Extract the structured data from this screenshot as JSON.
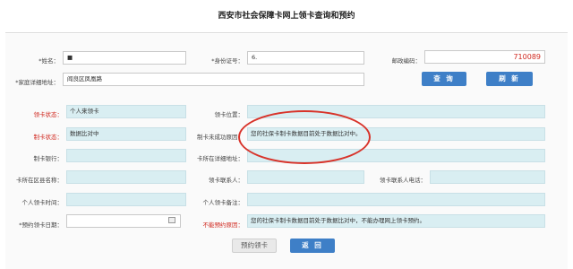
{
  "page": {
    "title": "西安市社会保障卡网上领卡查询和预约"
  },
  "query": {
    "name_label": "*姓名：",
    "name_value": "■",
    "id_label": "*身份证号：",
    "id_value": "6.",
    "postcode_label": "邮政编码：",
    "postcode_value": "710089",
    "address_label": "*家庭详细地址：",
    "address_value": "阎良区凤凰路",
    "search_button": "查 询",
    "refresh_button": "刷 新"
  },
  "result": {
    "status_label": "领卡状态：",
    "status_value": "个人来领卡",
    "position_label": "领卡位置：",
    "position_value": "",
    "card_status_label": "制卡状态：",
    "card_status_value": "数据比对中",
    "reason_label": "制卡未成功原因：",
    "reason_value": "您的社保卡制卡数据目前处于数据比对中。",
    "bank_label": "制卡银行：",
    "bank_value": "",
    "outlet_address_label": "卡所在详细地址：",
    "outlet_address_value": "",
    "outlet_name_label": "卡所在区县名称：",
    "outlet_name_value": "",
    "contact_label": "领卡联系人：",
    "contact_value": "",
    "contact_phone_label": "领卡联系人电话：",
    "contact_phone_value": "",
    "pickup_time_label": "个人领卡时间：",
    "pickup_time_value": "",
    "pickup_note_label": "个人领卡备注：",
    "pickup_note_value": "",
    "appointment_label": "*预约领卡日期：",
    "appointment_value": "",
    "no_appointment_label": "不能预约原因：",
    "no_appointment_value": "您的社保卡制卡数据目前处于数据比对中，不能办理网上领卡预约。"
  },
  "actions": {
    "reserve_button": "预约领卡",
    "back_button": "返 回"
  },
  "colors": {
    "accent": "#3e7fc7",
    "readonly_bg": "#d9eef2",
    "alert": "#d0281f"
  }
}
